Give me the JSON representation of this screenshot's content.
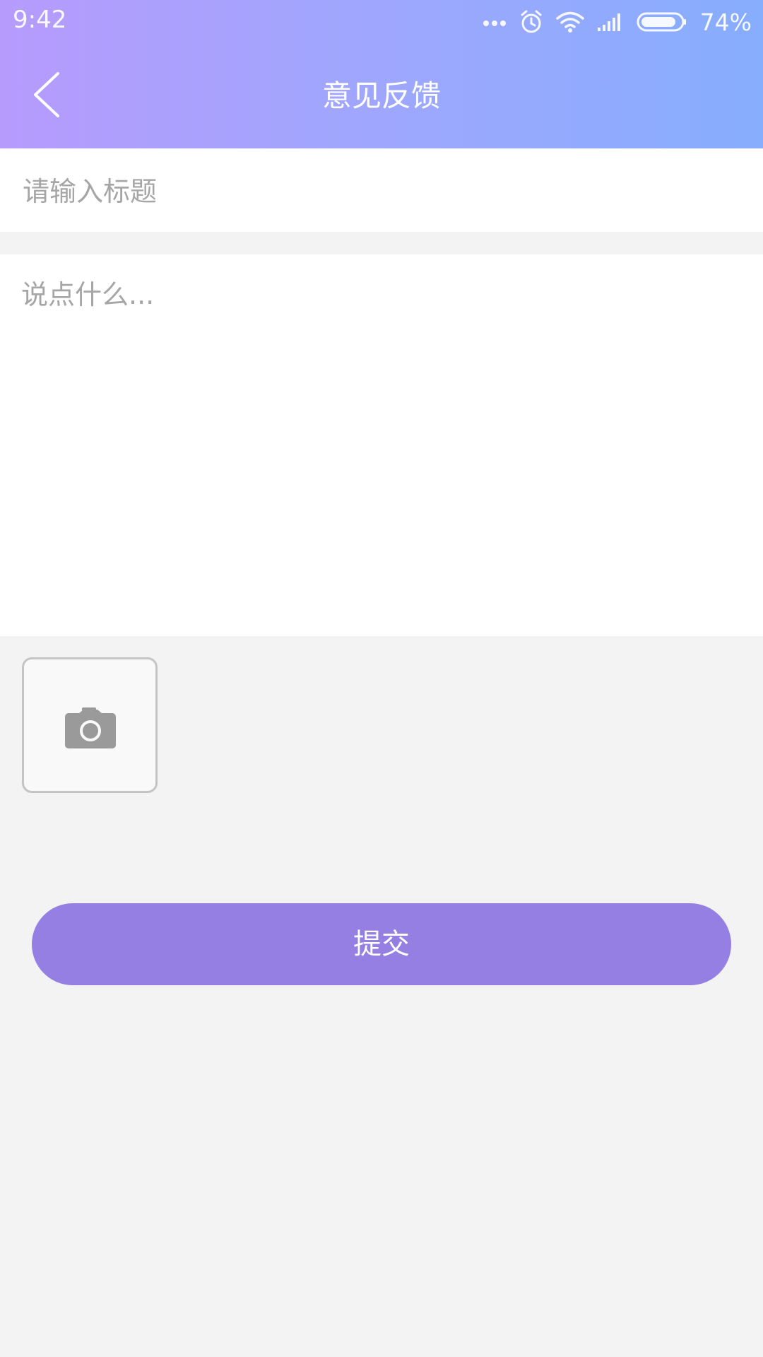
{
  "status_bar": {
    "time": "9:42",
    "battery_percent": "74%",
    "icons": [
      "more-dots-icon",
      "alarm-icon",
      "wifi-icon",
      "signal-icon",
      "battery-icon"
    ]
  },
  "nav": {
    "title": "意见反馈",
    "back_icon": "chevron-left-icon"
  },
  "form": {
    "title_placeholder": "请输入标题",
    "content_placeholder": "说点什么...",
    "photo_icon": "camera-icon"
  },
  "submit": {
    "label": "提交"
  },
  "colors": {
    "header_gradient_start": "#b69bfd",
    "header_gradient_end": "#87adfd",
    "submit_button": "#967fe3",
    "background": "#f3f3f3",
    "placeholder": "#a6a6a6"
  }
}
